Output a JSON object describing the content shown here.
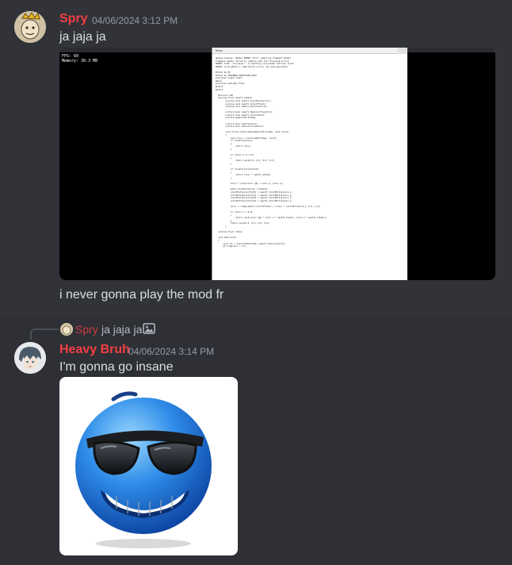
{
  "messages": [
    {
      "author": "Spry",
      "timestamp": "04/06/2024 3:12 PM",
      "content": "ja jaja ja",
      "followup": "i never gonna play the mod fr",
      "attachment": {
        "fps_lines": [
          "FPS: 60",
          "Memory: 30.3 MB"
        ],
        "dialog_title": "Error",
        "code_lines": [
          "OpenGL display. Header ERROR: Error compiling Fragment Shader",
          "Fragment shader failed to compile with the following errors:",
          "ERROR: 0:69: 'mix(vec4)': no matching overloaded function found",
          "ERROR: error(#273) 1 compilation errors. No code generated",
          "",
          "#ifdef GL_ES",
          "#ifdef GL_FRAGMENT_PRECISION_HIGH",
          "precision highp float;",
          "#else",
          "precision mediump float;",
          "#endif",
          "#endif",
          "",
          "  #version 120",
          "  varying float openfl_Alphav;",
          "        varying vec4 openfl_ColorMultiplierv;",
          "        varying vec4 openfl_ColorOffsetv;",
          "        varying vec2 openfl_TextureCoordv;",
          "",
          "        uniform bool openfl_HasColorTransform;",
          "        uniform vec2 openfl_TextureSize;",
          "        uniform sampler2D bitmap;",
          "",
          "        uniform bool hasTransform;",
          "        uniform bool hasColorTransform;",
          "",
          "        vec4 flixel_texture2D(sampler2D bitmap, vec2 coord)",
          "        {",
          "            vec4 color = texture2D(bitmap, coord);",
          "            if (!hasTransform)",
          "            {",
          "                return color;",
          "            }",
          "",
          "            if (color.a == 0.0)",
          "            {",
          "                return vec4(0.0, 0.0, 0.0, 0.0);",
          "            }",
          "",
          "            if (!hasColorTransform)",
          "            {",
          "                return color * openfl_Alphav;",
          "            }",
          "",
          "            color = vec4(color.rgb / color.a, color.a);",
          "",
          "            mat4 colorMultiplier = mat4(0);",
          "            colorMultiplier[0][0] = openfl_ColorMultiplierv.x;",
          "            colorMultiplier[1][1] = openfl_ColorMultiplierv.y;",
          "            colorMultiplier[2][2] = openfl_ColorMultiplierv.z;",
          "            colorMultiplier[3][3] = openfl_ColorMultiplierv.w;",
          "",
          "            color = clamp(openfl_ColorOffsetv + (color * colorMultiplier), 0.0, 1.0);",
          "",
          "            if (color.a > 0.0)",
          "            {",
          "                return vec4(color.rgb * color.a * openfl_Alphav, color.a * openfl_Alphav);",
          "            }",
          "            return vec4(0.0, 0.0, 0.0, 0.0);",
          "        }",
          "",
          "  uniform float uTime;",
          "",
          "  void main(void)",
          "  {",
          "      vec4 col = texture2D(bitmap, openfl_TextureCoordv);",
          "      gl_FragColor = col;"
        ]
      }
    },
    {
      "author": "Heavy Bruh",
      "timestamp": "04/06/2024 3:14 PM",
      "content": "I'm gonna go insane",
      "reply": {
        "author": "Spry",
        "content": "ja jaja ja"
      }
    }
  ],
  "colors": {
    "background": "#313338",
    "author_name": "#f23f43",
    "timestamp": "#949ba4",
    "text": "#dbdee1"
  }
}
